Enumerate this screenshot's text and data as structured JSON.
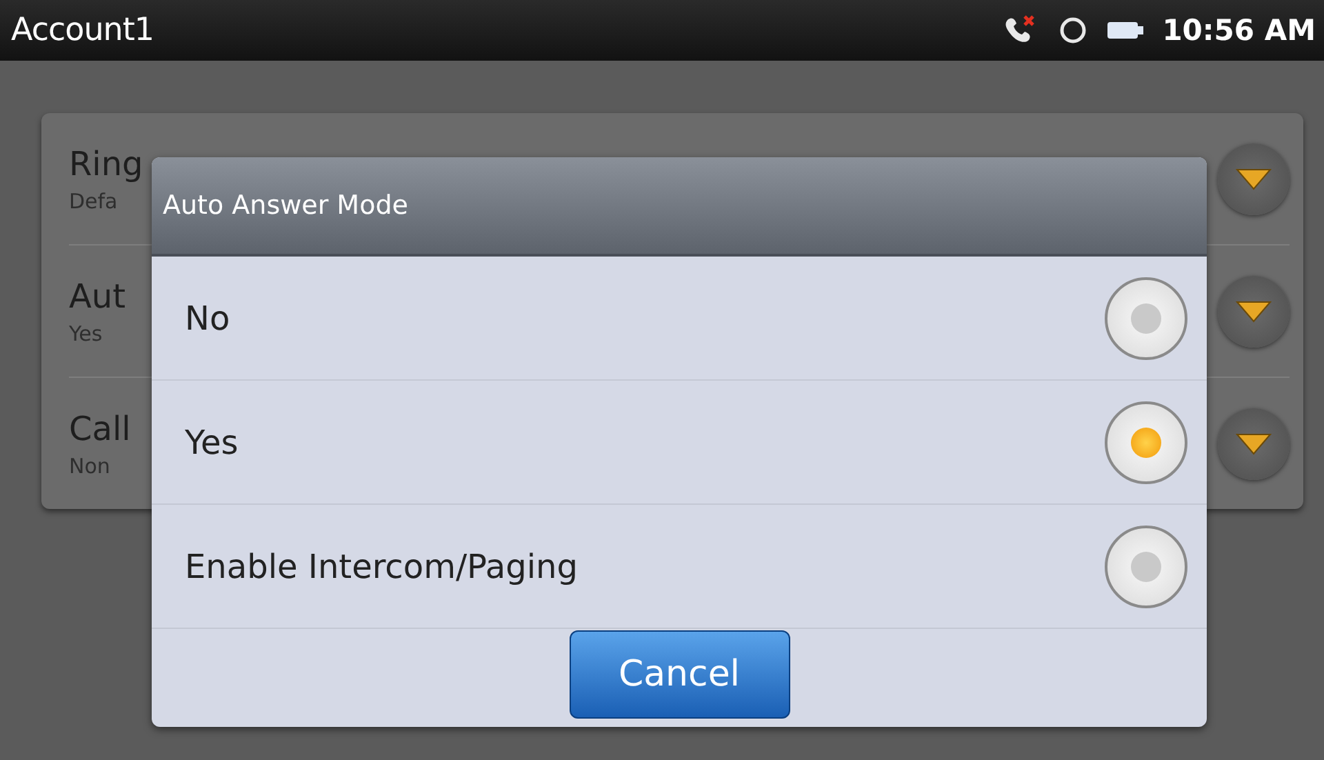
{
  "status_bar": {
    "title": "Account1",
    "time": "10:56 AM"
  },
  "settings": [
    {
      "title": "Ring",
      "value": "Defa"
    },
    {
      "title": "Aut",
      "value": "Yes"
    },
    {
      "title": "Call",
      "value": "Non"
    }
  ],
  "dialog": {
    "title": "Auto Answer Mode",
    "options": [
      {
        "label": "No",
        "selected": false
      },
      {
        "label": "Yes",
        "selected": true
      },
      {
        "label": "Enable Intercom/Paging",
        "selected": false
      }
    ],
    "cancel": "Cancel"
  }
}
